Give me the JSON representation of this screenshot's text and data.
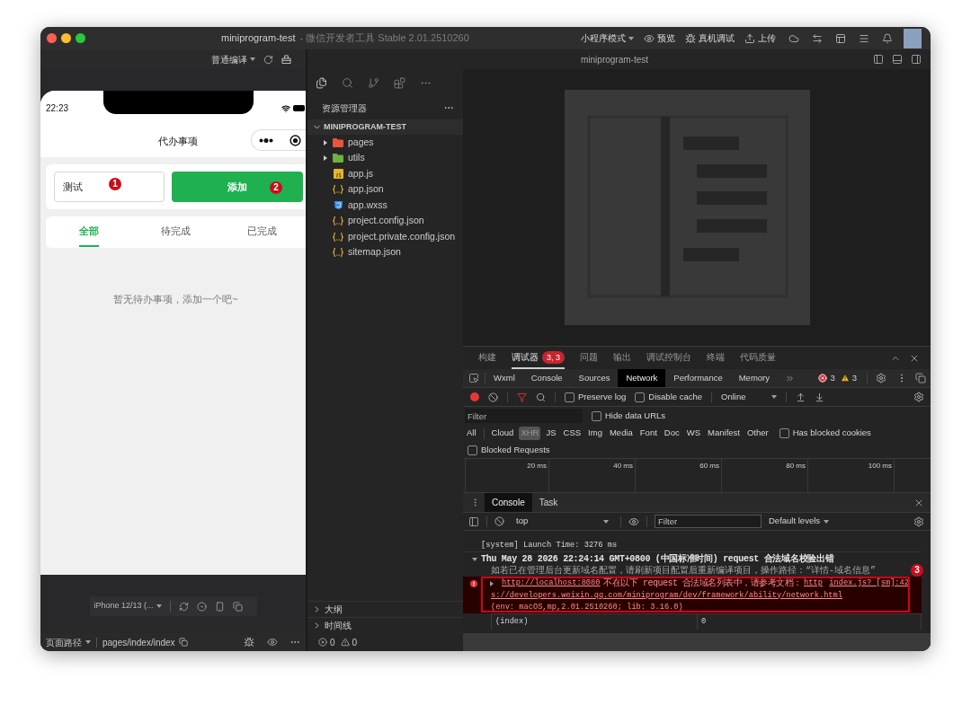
{
  "window": {
    "title": "miniprogram-test",
    "subtitle": "- 微信开发者工具 Stable 2.01.2510260"
  },
  "toolbar": {
    "mode": "小程序模式",
    "actions": [
      {
        "kind": "preview",
        "label": "预览"
      },
      {
        "kind": "remote_debug",
        "label": "真机调试"
      },
      {
        "kind": "upload",
        "label": "上传"
      }
    ]
  },
  "simulator": {
    "compile_mode": "普通编译",
    "phone": {
      "time": "22:23",
      "nav_title": "代办事项",
      "input_value": "测试",
      "add_button": "添加",
      "tabs": [
        {
          "label": "全部",
          "selected": true
        },
        {
          "label": "待完成",
          "selected": false
        },
        {
          "label": "已完成",
          "selected": false
        }
      ],
      "empty_text": "暂无待办事项，添加一个吧~"
    },
    "device": "iPhone 12/13 (..."
  },
  "editor": {
    "title": "miniprogram-test"
  },
  "explorer": {
    "title": "资源管理器",
    "project": {
      "name": "MINIPROGRAM-TEST",
      "expanded": true
    },
    "files": [
      {
        "name": "pages",
        "kind": "folder",
        "color": "#e8553b",
        "expanded": false
      },
      {
        "name": "utils",
        "kind": "folder",
        "color": "#6fb043",
        "expanded": false
      },
      {
        "name": "app.js",
        "kind": "js"
      },
      {
        "name": "app.json",
        "kind": "json"
      },
      {
        "name": "app.wxss",
        "kind": "css"
      },
      {
        "name": "project.config.json",
        "kind": "json"
      },
      {
        "name": "project.private.config.json",
        "kind": "json"
      },
      {
        "name": "sitemap.json",
        "kind": "json"
      }
    ],
    "sections": [
      {
        "label": "大纲",
        "expanded": false
      },
      {
        "label": "时间线",
        "expanded": false
      }
    ]
  },
  "devtools": {
    "panel_tabs": [
      {
        "label": "构建",
        "selected": false
      },
      {
        "label": "调试器",
        "selected": true,
        "badge": "3, 3"
      },
      {
        "label": "问题",
        "selected": false
      },
      {
        "label": "输出",
        "selected": false
      },
      {
        "label": "调试控制台",
        "selected": false
      },
      {
        "label": "终端",
        "selected": false
      },
      {
        "label": "代码质量",
        "selected": false
      }
    ],
    "tool_tabs": [
      {
        "label": "Wxml",
        "selected": false
      },
      {
        "label": "Console",
        "selected": false
      },
      {
        "label": "Sources",
        "selected": false
      },
      {
        "label": "Network",
        "selected": true
      },
      {
        "label": "Performance",
        "selected": false
      },
      {
        "label": "Memory",
        "selected": false
      }
    ],
    "error_count": "3",
    "warning_count": "3"
  },
  "network": {
    "preserve_log": {
      "label": "Preserve log",
      "checked": false
    },
    "disable_cache": {
      "label": "Disable cache",
      "checked": false
    },
    "throttling": "Online",
    "filter_placeholder": "Filter",
    "hide_data_urls": {
      "label": "Hide data URLs",
      "checked": false
    },
    "types": [
      {
        "label": "All",
        "selected": false
      },
      {
        "label": "Cloud",
        "selected": false
      },
      {
        "label": "XHR",
        "selected": true
      },
      {
        "label": "JS",
        "selected": false
      },
      {
        "label": "CSS",
        "selected": false
      },
      {
        "label": "Img",
        "selected": false
      },
      {
        "label": "Media",
        "selected": false
      },
      {
        "label": "Font",
        "selected": false
      },
      {
        "label": "Doc",
        "selected": false
      },
      {
        "label": "WS",
        "selected": false
      },
      {
        "label": "Manifest",
        "selected": false
      },
      {
        "label": "Other",
        "selected": false
      }
    ],
    "has_blocked_cookies": {
      "label": "Has blocked cookies",
      "checked": false
    },
    "blocked_requests": {
      "label": "Blocked Requests",
      "checked": false
    },
    "timeline_ticks": [
      "20 ms",
      "40 ms",
      "60 ms",
      "80 ms",
      "100 ms"
    ]
  },
  "console": {
    "drawer_tabs": [
      {
        "label": "Console",
        "selected": true
      },
      {
        "label": "Task",
        "selected": false
      }
    ],
    "context": "top",
    "filter_placeholder": "Filter",
    "levels": "Default levels",
    "messages": [
      {
        "kind": "log",
        "text": "[system] Launch Time: 3276 ms"
      },
      {
        "kind": "group",
        "expanded": true,
        "text": "Thu May 28 2026 22:24:14 GMT+0800 (中国标准时间) request 合法域名校验出错"
      },
      {
        "kind": "info",
        "text": "如若已在管理后台更新域名配置，请刷新项目配置后重新编译项目，操作路径：“详情-域名信息”"
      },
      {
        "kind": "error",
        "expanded": false,
        "url": "http://localhost:8080",
        "text": "不在以下 request 合法域名列表中，请参考文档：",
        "doc_link_start": "http",
        "doc_link_end": "s://developers.weixin.qq.com/miniprogram/dev/framework/ability/network.html",
        "source": "index.js? [sm]:42",
        "env": "(env: macOS,mp,2.01.2510260; lib: 3.16.0)"
      },
      {
        "kind": "table",
        "header": [
          "(index)",
          "0"
        ]
      }
    ]
  },
  "annotations": [
    {
      "label": "1"
    },
    {
      "label": "2"
    },
    {
      "label": "3"
    }
  ],
  "status_bar": {
    "page_path_label": "页面路径",
    "page_path": "pages/index/index",
    "errors": "0",
    "warnings": "0"
  }
}
